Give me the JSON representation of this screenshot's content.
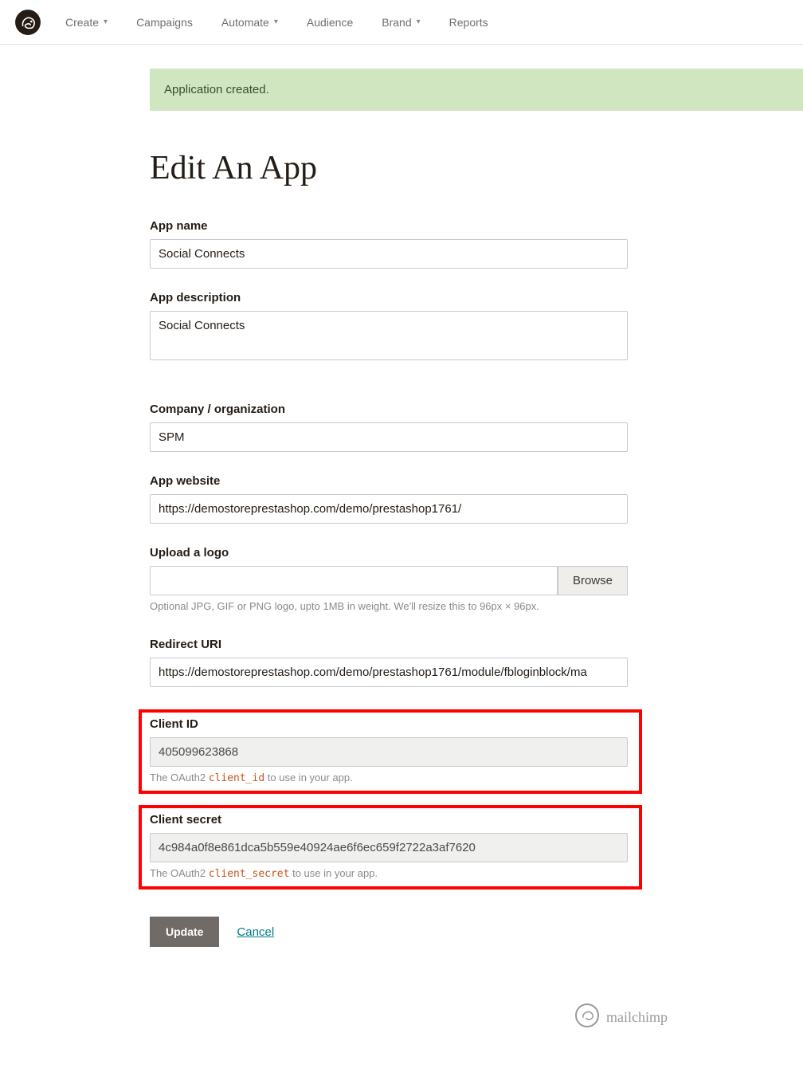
{
  "nav": {
    "create": "Create",
    "campaigns": "Campaigns",
    "automate": "Automate",
    "audience": "Audience",
    "brand": "Brand",
    "reports": "Reports"
  },
  "banner": {
    "message": "Application created."
  },
  "page": {
    "title": "Edit An App"
  },
  "form": {
    "app_name": {
      "label": "App name",
      "value": "Social Connects"
    },
    "app_desc": {
      "label": "App description",
      "value": "Social Connects"
    },
    "company": {
      "label": "Company / organization",
      "value": "SPM"
    },
    "website": {
      "label": "App website",
      "value": "https://demostoreprestashop.com/demo/prestashop1761/"
    },
    "upload": {
      "label": "Upload a logo",
      "browse": "Browse",
      "hint": "Optional JPG, GIF or PNG logo, upto 1MB in weight. We'll resize this to 96px × 96px."
    },
    "redirect": {
      "label": "Redirect URI",
      "value": "https://demostoreprestashop.com/demo/prestashop1761/module/fbloginblock/ma"
    },
    "client_id": {
      "label": "Client ID",
      "value": "405099623868",
      "hint_pre": "The OAuth2 ",
      "hint_code": "client_id",
      "hint_post": " to use in your app."
    },
    "client_secret": {
      "label": "Client secret",
      "value": "4c984a0f8e861dca5b559e40924ae6f6ec659f2722a3af7620",
      "hint_pre": "The OAuth2 ",
      "hint_code": "client_secret",
      "hint_post": " to use in your app."
    }
  },
  "actions": {
    "update": "Update",
    "cancel": "Cancel"
  },
  "footer": {
    "brand": "mailchimp"
  }
}
